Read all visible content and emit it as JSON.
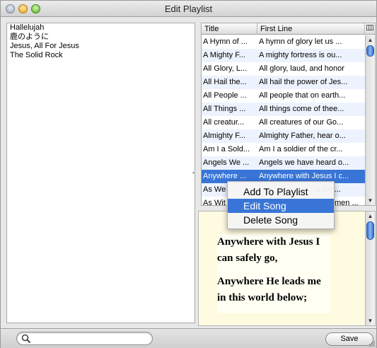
{
  "window": {
    "title": "Edit Playlist"
  },
  "playlist": {
    "items": [
      "Hallelujah",
      "鹿のように",
      "Jesus, All For Jesus",
      "The Solid Rock"
    ]
  },
  "songs_table": {
    "columns": [
      "Title",
      "First Line"
    ],
    "corner_icon": "column-options-icon",
    "rows": [
      [
        "A Hymn of ...",
        "A hymn of glory let us ..."
      ],
      [
        "A Mighty F...",
        "A mighty fortress is ou..."
      ],
      [
        "All Glory, L...",
        "All glory, laud, and honor"
      ],
      [
        "All Hail the...",
        "All hail the power of Jes..."
      ],
      [
        "All People ...",
        "All people that on earth..."
      ],
      [
        "All Things ...",
        "All things come of thee..."
      ],
      [
        "All creatur...",
        "All creatures of our Go..."
      ],
      [
        "Almighty F...",
        "Almighty Father, hear o..."
      ],
      [
        "Am I a Sold...",
        "Am I a soldier of the cr..."
      ],
      [
        "Angels We ...",
        "Angels we have heard o..."
      ],
      [
        "Anywhere ...",
        "Anywhere with Jesus I c..."
      ],
      [
        "As We",
        "s we ..."
      ],
      [
        "As Wit",
        "men ..."
      ]
    ],
    "selected_row": 10
  },
  "context_menu": {
    "items": [
      "Add To Playlist",
      "Edit Song",
      "Delete Song"
    ],
    "highlighted": 1
  },
  "lyrics_preview": {
    "stanzas": [
      "Anywhere with Jesus I can safely go,",
      "Anywhere He leads me in this world below;"
    ]
  },
  "bottom_bar": {
    "search_placeholder": "",
    "save_label": "Save"
  },
  "colors": {
    "selection": "#3875d7",
    "alt_row": "#edf3fe",
    "editor_background": "#fffbe0"
  }
}
